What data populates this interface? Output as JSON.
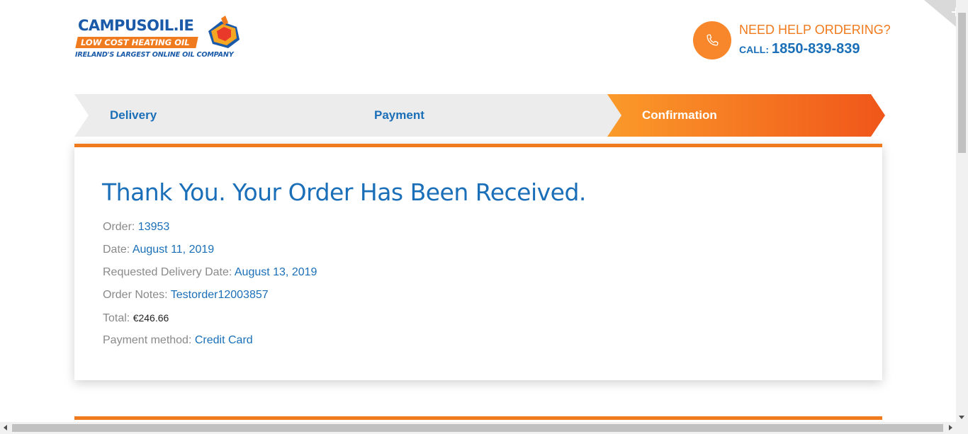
{
  "logo": {
    "brand": "CAMPUSOIL.IE",
    "tagline": "LOW COST HEATING OIL",
    "subline": "IRELAND'S LARGEST ONLINE OIL COMPANY"
  },
  "help": {
    "icon": "phone-icon",
    "title": "NEED HELP ORDERING?",
    "call_label": "CALL:",
    "phone": "1850-839-839"
  },
  "steps": [
    {
      "label": "Delivery",
      "state": "done"
    },
    {
      "label": "Payment",
      "state": "done"
    },
    {
      "label": "Confirmation",
      "state": "active"
    }
  ],
  "order": {
    "heading": "Thank You. Your Order Has Been Received.",
    "fields": [
      {
        "label": "Order:",
        "value": "13953"
      },
      {
        "label": "Date:",
        "value": "August 11, 2019"
      },
      {
        "label": "Requested Delivery Date:",
        "value": "August 13, 2019"
      },
      {
        "label": "Order Notes:",
        "value": "Testorder12003857"
      },
      {
        "label": "Total:",
        "value": "€246.66"
      },
      {
        "label": "Payment method:",
        "value": "Credit Card"
      }
    ]
  },
  "colors": {
    "brand_blue": "#1a6fb8",
    "brand_orange": "#f07a1e",
    "step_inactive": "#ececec"
  }
}
